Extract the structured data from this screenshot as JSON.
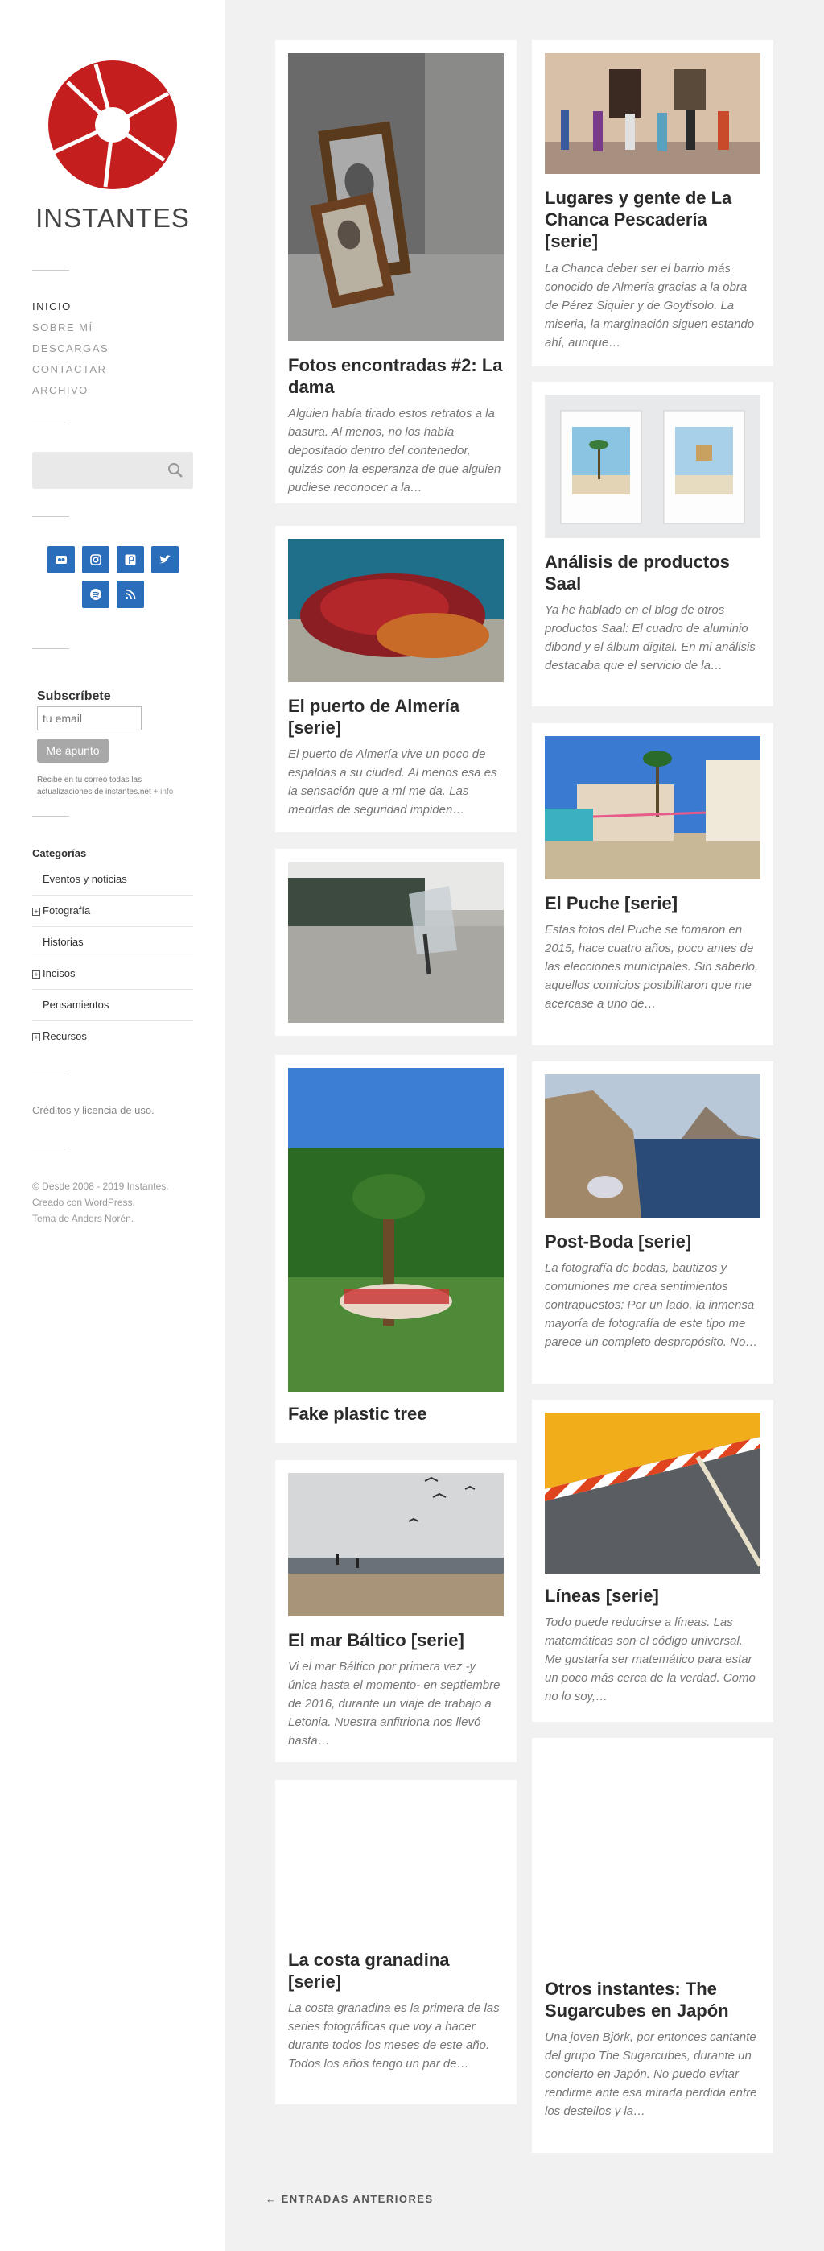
{
  "site": {
    "title": "INSTANTES",
    "logo_color": "#c41e1e"
  },
  "nav": {
    "items": [
      "INICIO",
      "SOBRE MÍ",
      "DESCARGAS",
      "CONTACTAR",
      "ARCHIVO"
    ]
  },
  "search": {
    "placeholder": "",
    "icon": "search-icon"
  },
  "social": {
    "color": "#2a6ebb",
    "icons": [
      "flickr-icon",
      "instagram-icon",
      "pinterest-icon",
      "twitter-icon",
      "spotify-icon",
      "rss-icon"
    ]
  },
  "subscribe": {
    "title": "Subscríbete",
    "placeholder": "tu email",
    "button": "Me apunto",
    "note": "Recibe en tu correo todas las actualizaciones de instantes.net",
    "info": "+ info"
  },
  "categories": {
    "heading": "Categorías",
    "items": [
      {
        "label": "Eventos y noticias",
        "expandable": false
      },
      {
        "label": "Fotografía",
        "expandable": true
      },
      {
        "label": "Historias",
        "expandable": false
      },
      {
        "label": "Incisos",
        "expandable": true
      },
      {
        "label": "Pensamientos",
        "expandable": false
      },
      {
        "label": "Recursos",
        "expandable": true
      }
    ]
  },
  "credits": "Créditos y licencia de uso.",
  "footer": {
    "line1": "© Desde 2008 - 2019 Instantes.",
    "line2": "Creado con WordPress.",
    "line3": "Tema de Anders Norén."
  },
  "posts": {
    "left": [
      {
        "title": "Fotos encontradas #2: La dama",
        "excerpt": "Alguien había tirado estos retratos a la basura. Al menos, no los había depositado dentro del contenedor, quizás con la esperanza de que alguien pudiese reconocer a la…"
      },
      {
        "title": "El puerto de Almería [serie]",
        "excerpt": "El puerto de Almería vive un poco de espaldas a su ciudad. Al menos esa es la sensación que a mí me da. Las medidas de seguridad impiden…"
      },
      {
        "title": "",
        "excerpt": ""
      },
      {
        "title": "Fake plastic tree",
        "excerpt": ""
      },
      {
        "title": "El mar Báltico [serie]",
        "excerpt": "Vi el mar Báltico por primera vez -y única hasta el momento- en septiembre de 2016, durante un viaje de trabajo a Letonia. Nuestra anfitriona nos llevó hasta…"
      },
      {
        "title": "La costa granadina [serie]",
        "excerpt": "La costa granadina es la primera de las series fotográficas que voy a hacer durante todos los meses de este año. Todos los años tengo un par de…"
      }
    ],
    "right": [
      {
        "title": "Lugares y gente de La Chanca Pescadería [serie]",
        "excerpt": "La Chanca deber ser el barrio más conocido de Almería gracias a la obra de Pérez Siquier y de Goytisolo. La miseria, la marginación siguen estando ahí, aunque…"
      },
      {
        "title": "Análisis de productos Saal",
        "excerpt": "Ya he hablado en el blog de otros productos Saal: El cuadro de aluminio dibond y el álbum digital. En mi análisis destacaba que el servicio de la…"
      },
      {
        "title": "El Puche [serie]",
        "excerpt": "Estas fotos del Puche se tomaron en 2015, hace cuatro años, poco antes de las elecciones municipales. Sin saberlo, aquellos comicios posibilitaron que me acercase a uno de…"
      },
      {
        "title": "Post-Boda [serie]",
        "excerpt": "La fotografía de bodas, bautizos y comuniones me crea sentimientos contrapuestos: Por un lado,  la inmensa mayoría de fotografía de este tipo me parece un completo despropósito. No…"
      },
      {
        "title": "Líneas [serie]",
        "excerpt": "Todo puede reducirse a líneas. Las matemáticas son el código universal. Me gustaría ser matemático para estar un poco más cerca de la verdad. Como no lo soy,…"
      },
      {
        "title": "Otros instantes: The Sugarcubes en Japón",
        "excerpt": "Una joven Björk, por entonces cantante del grupo  The Sugarcubes, durante un concierto en Japón. No puedo evitar rendirme ante esa mirada perdida entre los destellos y la…"
      }
    ]
  },
  "pagination": {
    "older": "← ENTRADAS ANTERIORES"
  }
}
